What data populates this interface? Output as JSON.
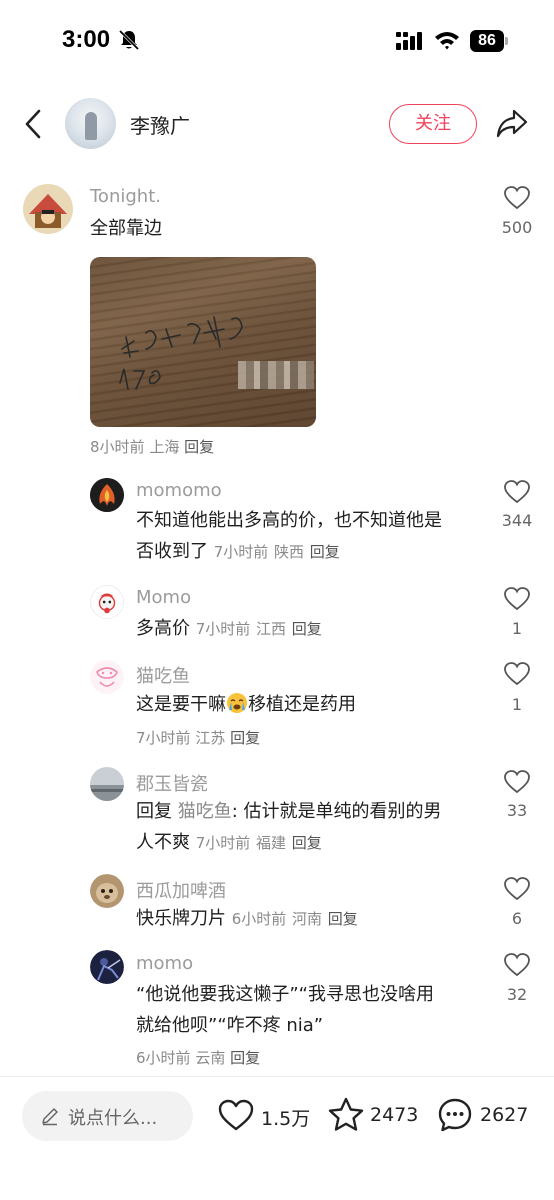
{
  "status_bar": {
    "time": "3:00",
    "battery": "86"
  },
  "header": {
    "author_name": "李豫广",
    "follow_label": "关注"
  },
  "main_comment": {
    "username": "Tonight.",
    "text": "全部靠边",
    "likes": "500",
    "time": "8小时前",
    "location": "上海",
    "reply_label": "回复"
  },
  "replies": [
    {
      "username": "momomo",
      "text_line1": "不知道他能出多高的价，也不知道他是",
      "text_line2": "否收到了",
      "time": "7小时前",
      "location": "陕西",
      "reply_label": "回复",
      "likes": "344"
    },
    {
      "username": "Momo",
      "text": "多高价",
      "time": "7小时前",
      "location": "江西",
      "reply_label": "回复",
      "likes": "1"
    },
    {
      "username": "猫吃鱼",
      "text_before": "这是要干嘛",
      "text_after": "移植还是药用",
      "time": "7小时前",
      "location": "江苏",
      "reply_label": "回复",
      "likes": "1"
    },
    {
      "username": "郡玉皆瓷",
      "reply_prefix": "回复",
      "reply_target": "猫吃鱼",
      "text_line1": ": 估计就是单纯的看别的男",
      "text_line2": "人不爽",
      "time": "7小时前",
      "location": "福建",
      "reply_label": "回复",
      "likes": "33"
    },
    {
      "username": "西瓜加啤酒",
      "text": "快乐牌刀片",
      "time": "6小时前",
      "location": "河南",
      "reply_label": "回复",
      "likes": "6"
    },
    {
      "username": "momo",
      "text_line1": "“他说他要我这懒子”“我寻思也没啥用",
      "text_line2": "就给他呗”“咋不疼 nia”",
      "time": "6小时前",
      "location": "云南",
      "reply_label": "回复",
      "likes": "32"
    }
  ],
  "bottom_bar": {
    "input_placeholder": "说点什么...",
    "likes": "1.5万",
    "favorites": "2473",
    "comments": "2627"
  },
  "icons": [
    "bell-slash-icon",
    "signal-icon",
    "wifi-icon",
    "back-icon",
    "share-icon",
    "heart-icon",
    "star-icon",
    "comment-icon",
    "pencil-icon"
  ],
  "colors": {
    "accent": "#f0435b",
    "username": "#9b9b9b",
    "meta": "#8a8a8a"
  }
}
